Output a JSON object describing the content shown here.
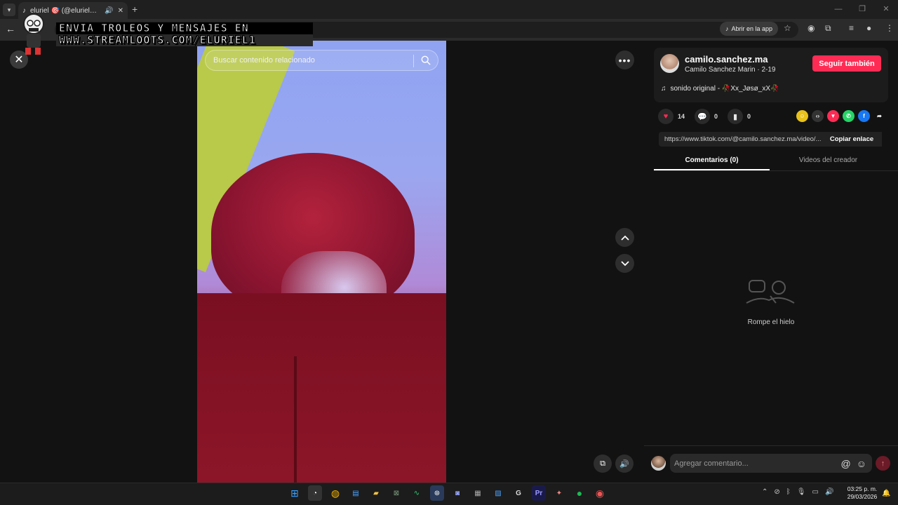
{
  "browser": {
    "tab_title": "eluriel 🎯 (@eluriel095) | TikTok",
    "tab_list_icon": "chevron-down-icon",
    "new_tab_label": "+",
    "open_app_label": "Abrir en la app"
  },
  "overlay": {
    "line1": "ENVIA TROLEOS Y MENSAJES EN",
    "line2": "WWW.STREAMLOOTS.COM/ELURIEL1"
  },
  "video": {
    "search_placeholder": "Buscar contenido relacionado"
  },
  "creator": {
    "username": "camilo.sanchez.ma",
    "subtitle": "Camilo Sanchez Marin · 2-19",
    "follow_label": "Seguir también",
    "music": "sonido original - 🥀Xx_Jøsø_xX🥀"
  },
  "stats": {
    "likes": "14",
    "comments": "0",
    "saves": "0"
  },
  "share": {
    "url": "https://www.tiktok.com/@camilo.sanchez.ma/video/...",
    "copy_label": "Copiar enlace"
  },
  "tabs": {
    "comments": "Comentarios (0)",
    "creator_videos": "Videos del creador"
  },
  "empty": {
    "text": "Rompe el hielo"
  },
  "comment": {
    "placeholder": "Agregar comentario..."
  },
  "taskbar": {
    "time": "03:25 p. m.",
    "date": "29/03/2026"
  },
  "colors": {
    "accent": "#fe2c55",
    "background": "#121212"
  }
}
